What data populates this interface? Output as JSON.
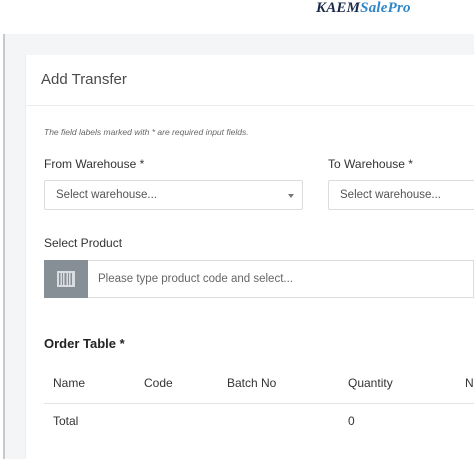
{
  "brand": {
    "part1": "KAEM",
    "part2": "SalePro"
  },
  "form": {
    "title": "Add Transfer",
    "required_note": "The field labels marked with * are required input fields.",
    "from_warehouse": {
      "label": "From Warehouse *",
      "placeholder": "Select warehouse..."
    },
    "to_warehouse": {
      "label": "To Warehouse *",
      "placeholder": "Select warehouse..."
    },
    "product": {
      "label": "Select Product",
      "placeholder": "Please type product code and select...",
      "scan_icon": "barcode-icon"
    }
  },
  "order_table": {
    "title": "Order Table *",
    "headers": [
      "Name",
      "Code",
      "Batch No",
      "Quantity",
      "N"
    ],
    "footer": {
      "label": "Total",
      "quantity": "0"
    }
  },
  "colors": {
    "brand_dark": "#1a2a4a",
    "brand_accent": "#2f86c8",
    "scan_button": "#868e96"
  }
}
